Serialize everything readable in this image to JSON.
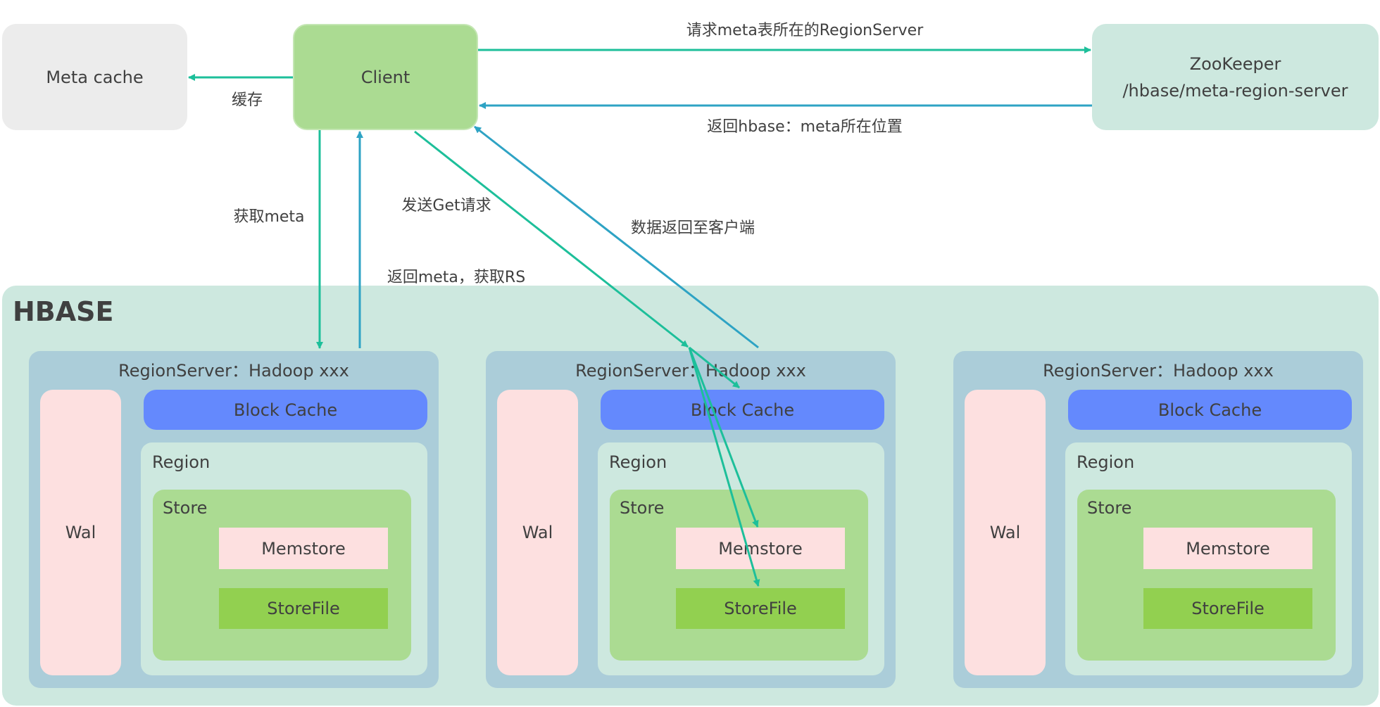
{
  "nodes": {
    "meta_cache": "Meta cache",
    "client": "Client",
    "zookeeper_line1": "ZooKeeper",
    "zookeeper_line2": "/hbase/meta-region-server",
    "hbase": "HBASE"
  },
  "edges": {
    "cache": "缓存",
    "request_meta_rs": "请求meta表所在的RegionServer",
    "return_meta_location": "返回hbase：meta所在位置",
    "get_meta": "获取meta",
    "return_meta_get_rs": "返回meta，获取RS",
    "send_get": "发送Get请求",
    "data_return": "数据返回至客户端"
  },
  "regionservers": [
    {
      "title": "RegionServer：Hadoop xxx",
      "wal": "Wal",
      "block_cache": "Block Cache",
      "region": "Region",
      "store": "Store",
      "memstore": "Memstore",
      "storefile": "StoreFile"
    },
    {
      "title": "RegionServer：Hadoop xxx",
      "wal": "Wal",
      "block_cache": "Block Cache",
      "region": "Region",
      "store": "Store",
      "memstore": "Memstore",
      "storefile": "StoreFile"
    },
    {
      "title": "RegionServer：Hadoop xxx",
      "wal": "Wal",
      "block_cache": "Block Cache",
      "region": "Region",
      "store": "Store",
      "memstore": "Memstore",
      "storefile": "StoreFile"
    }
  ],
  "colors": {
    "request_arrow": "#1dbf9a",
    "response_arrow": "#2ea3c4",
    "client": "#abdb92",
    "zookeeper": "#cde8df",
    "regionserver": "#abcdd9",
    "block_cache": "#6489fd",
    "wal": "#fde0e0",
    "storefile": "#92d050"
  }
}
